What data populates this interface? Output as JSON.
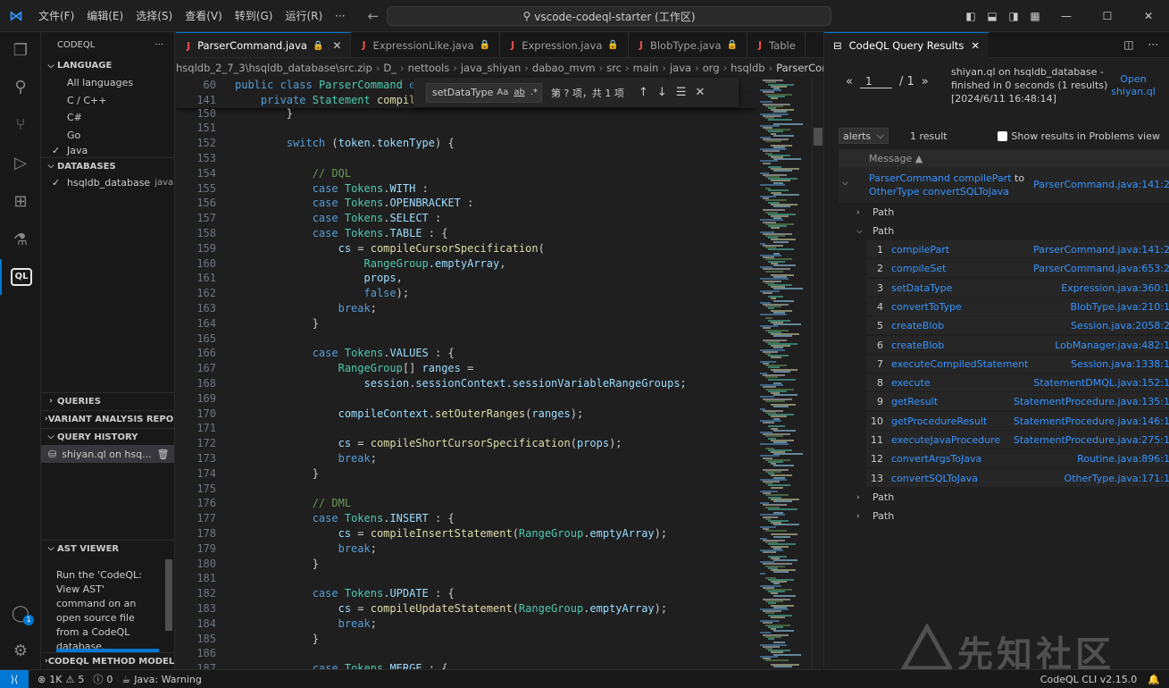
{
  "titlebar": {
    "menus": [
      "文件(F)",
      "编辑(E)",
      "选择(S)",
      "查看(V)",
      "转到(G)",
      "运行(R)",
      "···"
    ],
    "search": "vscode-codeql-starter (工作区)"
  },
  "sidebar": {
    "title": "CODEQL",
    "language_header": "LANGUAGE",
    "languages": [
      {
        "label": "All languages",
        "checked": false
      },
      {
        "label": "C / C++",
        "checked": false
      },
      {
        "label": "C#",
        "checked": false
      },
      {
        "label": "Go",
        "checked": false
      },
      {
        "label": "Java",
        "checked": true
      }
    ],
    "databases_header": "DATABASES",
    "database": {
      "name": "hsqldb_database",
      "lang": "java"
    },
    "queries_header": "QUERIES",
    "variant_header": "VARIANT ANALYSIS REPO...",
    "history_header": "QUERY HISTORY",
    "history_item": "shiyan.ql on hsq...",
    "ast_header": "AST VIEWER",
    "ast_text": "Run the 'CodeQL: View AST' command on an open source file from a CodeQL database.",
    "method_header": "CODEQL METHOD MODELI..."
  },
  "editor": {
    "tabs": [
      {
        "label": "ParserCommand.java",
        "active": true
      },
      {
        "label": "ExpressionLike.java",
        "active": false
      },
      {
        "label": "Expression.java",
        "active": false
      },
      {
        "label": "BlobType.java",
        "active": false
      },
      {
        "label": "Table",
        "active": false
      }
    ],
    "breadcrumb": [
      "hsqldb_2_7_3\\hsqldb_database\\src.zip",
      "D_",
      "nettools",
      "java_shiyan",
      "dabao_mvm",
      "src",
      "main",
      "java",
      "org",
      "hsqldb",
      "ParserCommand"
    ],
    "find": {
      "query": "setDataType",
      "opts": [
        "Aa",
        "ab",
        ".*"
      ],
      "count": "第 ? 项，共 1 项"
    }
  },
  "code_lines": [
    {
      "n": "60",
      "html": "<span class='kw'>public class</span> <span class='ty'>ParserCommand</span> <span class='kw'>ex</span>"
    },
    {
      "n": "141",
      "html": "    <span class='kw'>private</span> <span class='ty'>Statement</span> <span class='fn'>compile</span>"
    },
    {
      "n": "150",
      "html": "        }"
    },
    {
      "n": "151",
      "html": ""
    },
    {
      "n": "152",
      "html": "        <span class='kw'>switch</span> (<span class='vr'>token</span>.<span class='vr'>tokenType</span>) {"
    },
    {
      "n": "153",
      "html": ""
    },
    {
      "n": "154",
      "html": "            <span class='cm'>// DQL</span>"
    },
    {
      "n": "155",
      "html": "            <span class='kw'>case</span> <span class='ty'>Tokens</span>.<span class='vr'>WITH</span> :"
    },
    {
      "n": "156",
      "html": "            <span class='kw'>case</span> <span class='ty'>Tokens</span>.<span class='vr'>OPENBRACKET</span> :"
    },
    {
      "n": "157",
      "html": "            <span class='kw'>case</span> <span class='ty'>Tokens</span>.<span class='vr'>SELECT</span> :"
    },
    {
      "n": "158",
      "html": "            <span class='kw'>case</span> <span class='ty'>Tokens</span>.<span class='vr'>TABLE</span> : {"
    },
    {
      "n": "159",
      "html": "                <span class='vr'>cs</span> = <span class='fn'>compileCursorSpecification</span>("
    },
    {
      "n": "160",
      "html": "                    <span class='ty'>RangeGroup</span>.<span class='vr'>emptyArray</span>,"
    },
    {
      "n": "161",
      "html": "                    <span class='vr'>props</span>,"
    },
    {
      "n": "162",
      "html": "                    <span class='kw'>false</span>);"
    },
    {
      "n": "163",
      "html": "                <span class='kw'>break</span>;"
    },
    {
      "n": "164",
      "html": "            }"
    },
    {
      "n": "165",
      "html": ""
    },
    {
      "n": "166",
      "html": "            <span class='kw'>case</span> <span class='ty'>Tokens</span>.<span class='vr'>VALUES</span> : {"
    },
    {
      "n": "167",
      "html": "                <span class='ty'>RangeGroup</span>[] <span class='vr'>ranges</span> ="
    },
    {
      "n": "168",
      "html": "                    <span class='vr'>session</span>.<span class='vr'>sessionContext</span>.<span class='vr'>sessionVariableRangeGroups</span>;"
    },
    {
      "n": "169",
      "html": ""
    },
    {
      "n": "170",
      "html": "                <span class='vr'>compileContext</span>.<span class='fn'>setOuterRanges</span>(<span class='vr'>ranges</span>);"
    },
    {
      "n": "171",
      "html": ""
    },
    {
      "n": "172",
      "html": "                <span class='vr'>cs</span> = <span class='fn'>compileShortCursorSpecification</span>(<span class='vr'>props</span>);"
    },
    {
      "n": "173",
      "html": "                <span class='kw'>break</span>;"
    },
    {
      "n": "174",
      "html": "            }"
    },
    {
      "n": "175",
      "html": ""
    },
    {
      "n": "176",
      "html": "            <span class='cm'>// DML</span>"
    },
    {
      "n": "177",
      "html": "            <span class='kw'>case</span> <span class='ty'>Tokens</span>.<span class='vr'>INSERT</span> : {"
    },
    {
      "n": "178",
      "html": "                <span class='vr'>cs</span> = <span class='fn'>compileInsertStatement</span>(<span class='ty'>RangeGroup</span>.<span class='vr'>emptyArray</span>);"
    },
    {
      "n": "179",
      "html": "                <span class='kw'>break</span>;"
    },
    {
      "n": "180",
      "html": "            }"
    },
    {
      "n": "181",
      "html": ""
    },
    {
      "n": "182",
      "html": "            <span class='kw'>case</span> <span class='ty'>Tokens</span>.<span class='vr'>UPDATE</span> : {"
    },
    {
      "n": "183",
      "html": "                <span class='vr'>cs</span> = <span class='fn'>compileUpdateStatement</span>(<span class='ty'>RangeGroup</span>.<span class='vr'>emptyArray</span>);"
    },
    {
      "n": "184",
      "html": "                <span class='kw'>break</span>;"
    },
    {
      "n": "185",
      "html": "            }"
    },
    {
      "n": "186",
      "html": ""
    },
    {
      "n": "187",
      "html": "            <span class='kw'>case</span> <span class='ty'>Tokens</span>.<span class='vr'>MERGE</span> : {"
    }
  ],
  "results": {
    "tab_title": "CodeQL Query Results",
    "page_current": "1",
    "page_total": "/ 1",
    "summary": "shiyan.ql on hsqldb_database - finished in 0 seconds (1 results) [2024/6/11 16:48:14]",
    "open_link": "Open shiyan.ql",
    "select": "alerts",
    "count": "1 result",
    "checkbox_label": "Show results in Problems view",
    "col_message": "Message ▲",
    "alert": {
      "link1": "ParserCommand compilePart",
      "to": " to ",
      "link2": "OtherType convertSQLToJava",
      "loc": "ParserCommand.java:141:2"
    },
    "path_label": "Path",
    "steps": [
      {
        "n": "1",
        "fn": "compilePart",
        "loc": "ParserCommand.java:141:2"
      },
      {
        "n": "2",
        "fn": "compileSet",
        "loc": "ParserCommand.java:653:2"
      },
      {
        "n": "3",
        "fn": "setDataType",
        "loc": "Expression.java:360:1"
      },
      {
        "n": "4",
        "fn": "convertToType",
        "loc": "BlobType.java:210:1"
      },
      {
        "n": "5",
        "fn": "createBlob",
        "loc": "Session.java:2058:2"
      },
      {
        "n": "6",
        "fn": "createBlob",
        "loc": "LobManager.java:482:1"
      },
      {
        "n": "7",
        "fn": "executeCompiledStatement",
        "loc": "Session.java:1338:1"
      },
      {
        "n": "8",
        "fn": "execute",
        "loc": "StatementDMQL.java:152:1"
      },
      {
        "n": "9",
        "fn": "getResult",
        "loc": "StatementProcedure.java:135:1"
      },
      {
        "n": "10",
        "fn": "getProcedureResult",
        "loc": "StatementProcedure.java:146:1"
      },
      {
        "n": "11",
        "fn": "executeJavaProcedure",
        "loc": "StatementProcedure.java:275:1"
      },
      {
        "n": "12",
        "fn": "convertArgsToJava",
        "loc": "Routine.java:896:1"
      },
      {
        "n": "13",
        "fn": "convertSQLToJava",
        "loc": "OtherType.java:171:1"
      }
    ]
  },
  "statusbar": {
    "errors": "1K",
    "warnings": "5",
    "info": "0",
    "java": "Java: Warning",
    "cli": "CodeQL CLI v2.15.0"
  },
  "watermark": "先知社区",
  "colors": {
    "accent": "#0078d4",
    "link": "#3794ff",
    "error_icon": "#f14c4c"
  }
}
